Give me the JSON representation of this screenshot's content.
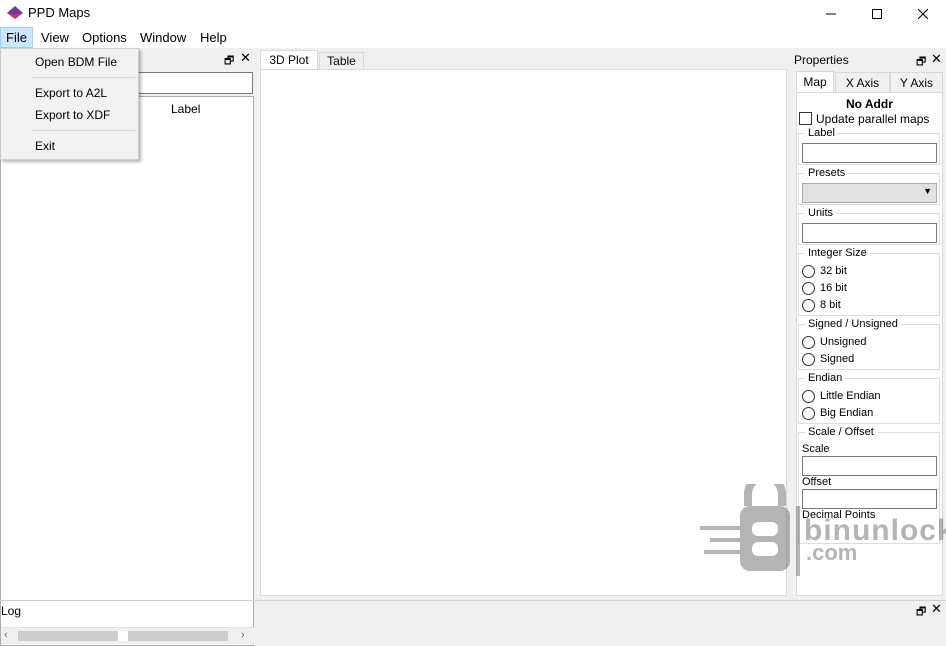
{
  "window": {
    "title": "PPD Maps"
  },
  "menubar": {
    "items": [
      "File",
      "View",
      "Options",
      "Window",
      "Help"
    ]
  },
  "file_menu": {
    "items": [
      "Open BDM File",
      "Export to A2L",
      "Export to XDF",
      "Exit"
    ]
  },
  "left_panel": {
    "column_header": "Label"
  },
  "center": {
    "tabs": [
      "3D Plot",
      "Table"
    ]
  },
  "properties": {
    "title": "Properties",
    "tabs": [
      "Map",
      "X Axis",
      "Y Axis"
    ],
    "address": "No Addr",
    "update_parallel": "Update parallel maps",
    "label_group": "Label",
    "presets_group": "Presets",
    "units_group": "Units",
    "integer_size": {
      "title": "Integer Size",
      "options": [
        "32 bit",
        "16 bit",
        "8 bit"
      ]
    },
    "signed": {
      "title": "Signed / Unsigned",
      "options": [
        "Unsigned",
        "Signed"
      ]
    },
    "endian": {
      "title": "Endian",
      "options": [
        "Little Endian",
        "Big Endian"
      ]
    },
    "scale_offset": {
      "title": "Scale / Offset",
      "scale": "Scale",
      "offset": "Offset",
      "decimal": "Decimal Points"
    }
  },
  "log": {
    "title": "Log"
  },
  "watermark": {
    "text": "binunlock",
    "sub": ".com"
  }
}
